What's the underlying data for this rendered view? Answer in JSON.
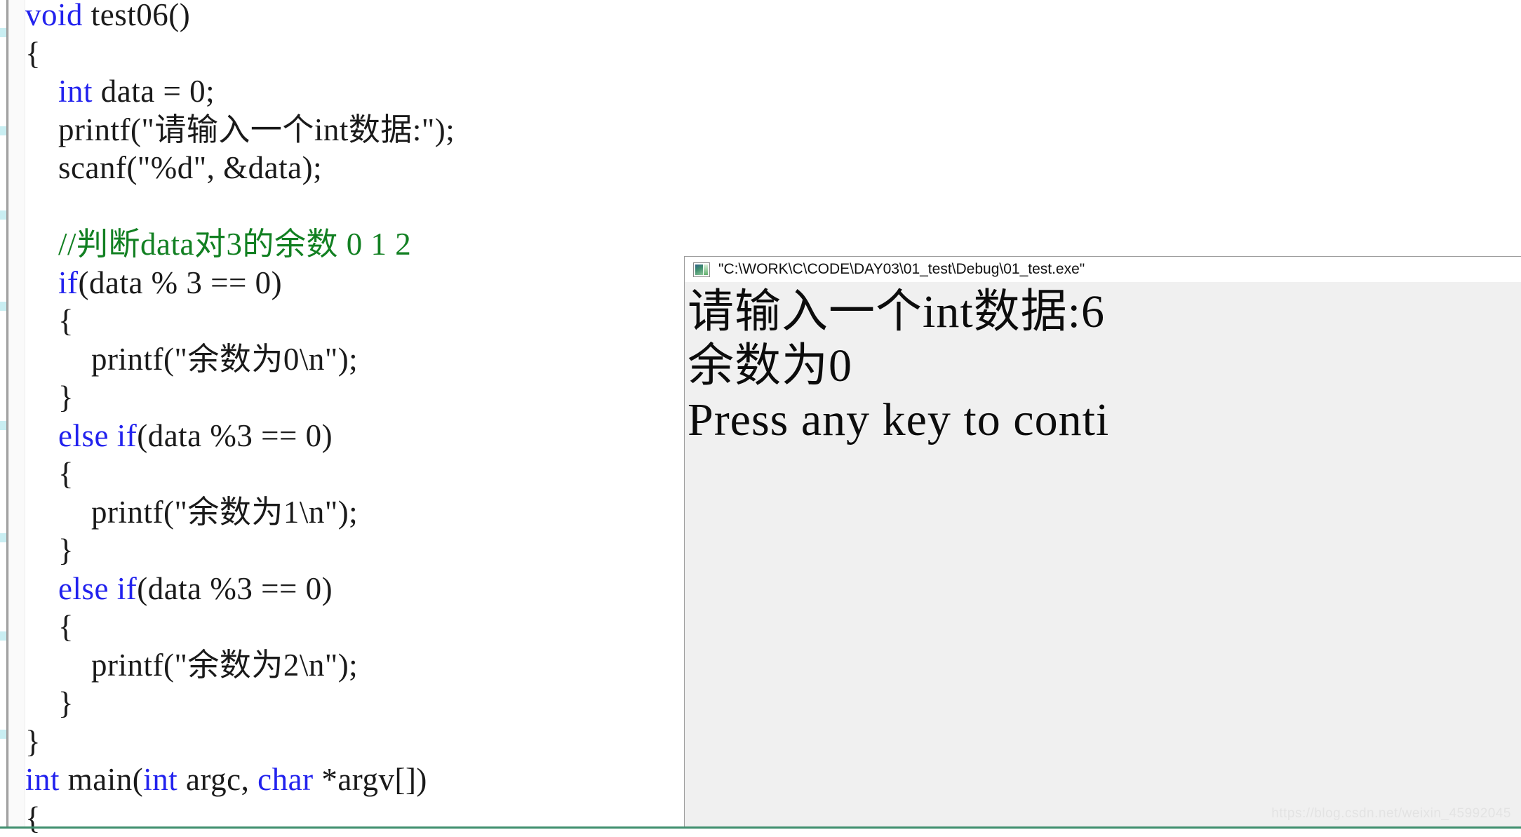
{
  "editor": {
    "name": "code-editor",
    "language": "c",
    "gutter_marks": 6,
    "colors": {
      "keyword": "#2222ee",
      "comment": "#128022",
      "text": "#1a1a1a",
      "background": "#ffffff"
    },
    "lines": [
      {
        "indent": 0,
        "tokens": [
          {
            "cls": "kw",
            "t": "void"
          },
          {
            "cls": "plain",
            "t": " test06()"
          }
        ]
      },
      {
        "indent": 0,
        "tokens": [
          {
            "cls": "plain",
            "t": "{"
          }
        ]
      },
      {
        "indent": 0,
        "tokens": [
          {
            "cls": "plain",
            "t": "    "
          },
          {
            "cls": "kw",
            "t": "int"
          },
          {
            "cls": "plain",
            "t": " data = 0;"
          }
        ]
      },
      {
        "indent": 0,
        "tokens": [
          {
            "cls": "plain",
            "t": "    printf(\"请输入一个int数据:\");"
          }
        ]
      },
      {
        "indent": 0,
        "tokens": [
          {
            "cls": "plain",
            "t": "    scanf(\"%d\", &data);"
          }
        ]
      },
      {
        "indent": 0,
        "tokens": [
          {
            "cls": "plain",
            "t": ""
          }
        ]
      },
      {
        "indent": 0,
        "tokens": [
          {
            "cls": "cmt",
            "t": "    //判断data对3的余数 0 1 2"
          }
        ]
      },
      {
        "indent": 0,
        "tokens": [
          {
            "cls": "plain",
            "t": "    "
          },
          {
            "cls": "kw",
            "t": "if"
          },
          {
            "cls": "plain",
            "t": "(data % 3 == 0)"
          }
        ]
      },
      {
        "indent": 0,
        "tokens": [
          {
            "cls": "plain",
            "t": "    {"
          }
        ]
      },
      {
        "indent": 0,
        "tokens": [
          {
            "cls": "plain",
            "t": "        printf(\"余数为0\\n\");"
          }
        ]
      },
      {
        "indent": 0,
        "tokens": [
          {
            "cls": "plain",
            "t": "    }"
          }
        ]
      },
      {
        "indent": 0,
        "tokens": [
          {
            "cls": "plain",
            "t": "    "
          },
          {
            "cls": "kw",
            "t": "else if"
          },
          {
            "cls": "plain",
            "t": "(data %3 == 0)"
          }
        ]
      },
      {
        "indent": 0,
        "tokens": [
          {
            "cls": "plain",
            "t": "    {"
          }
        ]
      },
      {
        "indent": 0,
        "tokens": [
          {
            "cls": "plain",
            "t": "        printf(\"余数为1\\n\");"
          }
        ]
      },
      {
        "indent": 0,
        "tokens": [
          {
            "cls": "plain",
            "t": "    }"
          }
        ]
      },
      {
        "indent": 0,
        "tokens": [
          {
            "cls": "plain",
            "t": "    "
          },
          {
            "cls": "kw",
            "t": "else if"
          },
          {
            "cls": "plain",
            "t": "(data %3 == 0)"
          }
        ]
      },
      {
        "indent": 0,
        "tokens": [
          {
            "cls": "plain",
            "t": "    {"
          }
        ]
      },
      {
        "indent": 0,
        "tokens": [
          {
            "cls": "plain",
            "t": "        printf(\"余数为2\\n\");"
          }
        ]
      },
      {
        "indent": 0,
        "tokens": [
          {
            "cls": "plain",
            "t": "    }"
          }
        ]
      },
      {
        "indent": 0,
        "tokens": [
          {
            "cls": "plain",
            "t": "}"
          }
        ]
      },
      {
        "indent": 0,
        "tokens": [
          {
            "cls": "kw",
            "t": "int"
          },
          {
            "cls": "plain",
            "t": " main("
          },
          {
            "cls": "kw",
            "t": "int"
          },
          {
            "cls": "plain",
            "t": " argc, "
          },
          {
            "cls": "kw",
            "t": "char"
          },
          {
            "cls": "plain",
            "t": " *argv[])"
          }
        ]
      },
      {
        "indent": 0,
        "tokens": [
          {
            "cls": "plain",
            "t": "{"
          }
        ]
      }
    ]
  },
  "console": {
    "icon": "console-app-icon",
    "title": "\"C:\\WORK\\C\\CODE\\DAY03\\01_test\\Debug\\01_test.exe\"",
    "output_lines": [
      "请输入一个int数据:6",
      "余数为0",
      "Press any key to conti"
    ]
  },
  "watermark": {
    "text": "https://blog.csdn.net/weixin_45992045"
  }
}
